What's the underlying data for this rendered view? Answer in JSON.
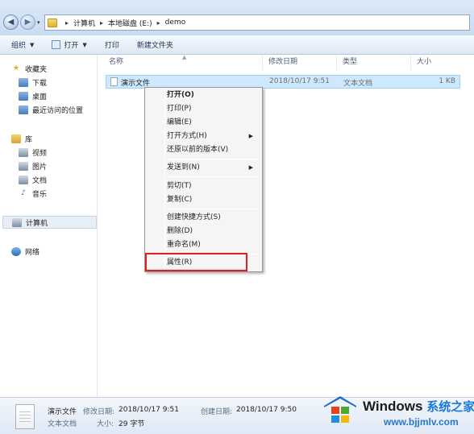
{
  "address_bar": {
    "breadcrumbs": [
      "计算机",
      "本地磁盘 (E:)",
      "demo"
    ]
  },
  "toolbar": {
    "organize": "组织",
    "open": "打开",
    "print": "打印",
    "new_folder": "新建文件夹"
  },
  "nav_pane": {
    "favorites": "收藏夹",
    "downloads": "下载",
    "desktop": "桌面",
    "recent": "最近访问的位置",
    "libraries": "库",
    "videos": "视频",
    "pictures": "图片",
    "documents": "文档",
    "music": "音乐",
    "computer": "计算机",
    "network": "网络"
  },
  "columns": {
    "name": "名称",
    "modified": "修改日期",
    "type": "类型",
    "size": "大小"
  },
  "file": {
    "name": "演示文件",
    "modified": "2018/10/17 9:51",
    "type": "文本文档",
    "size": "1 KB"
  },
  "context_menu": {
    "open": "打开(O)",
    "print": "打印(P)",
    "edit": "编辑(E)",
    "open_with": "打开方式(H)",
    "restore": "还原以前的版本(V)",
    "send_to": "发送到(N)",
    "cut": "剪切(T)",
    "copy": "复制(C)",
    "shortcut": "创建快捷方式(S)",
    "delete": "删除(D)",
    "rename": "重命名(M)",
    "properties": "属性(R)"
  },
  "details": {
    "name": "演示文件",
    "modified_label": "修改日期:",
    "modified_value": "2018/10/17 9:51",
    "created_label": "创建日期:",
    "created_value": "2018/10/17 9:50",
    "type": "文本文档",
    "size_label": "大小:",
    "size_value": "29 字节"
  },
  "watermark": {
    "title": "Windows",
    "title_cn": "系统之家",
    "url": "www.bjjmlv.com"
  },
  "colors": {
    "highlight_box": "#e21e1e",
    "selection": "#cde8ff"
  }
}
